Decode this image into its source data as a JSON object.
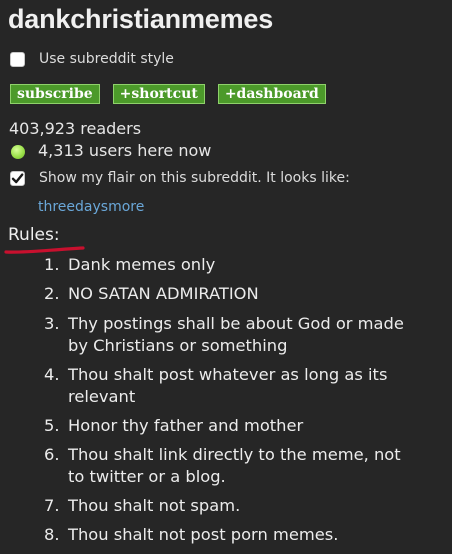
{
  "subreddit": {
    "name": "dankchristianmemes"
  },
  "style_option": {
    "label": "Use subreddit style",
    "checked": false
  },
  "buttons": {
    "subscribe": "subscribe",
    "shortcut": "+shortcut",
    "dashboard": "+dashboard"
  },
  "stats": {
    "readers": "403,923 readers",
    "online": "4,313 users here now"
  },
  "flair": {
    "label": "Show my flair on this subreddit. It looks like:",
    "checked": true,
    "value": "threedaysmore"
  },
  "rules": {
    "heading": "Rules:",
    "items": [
      {
        "num": "1.",
        "lines": [
          "Dank memes only"
        ]
      },
      {
        "num": "2.",
        "lines": [
          "NO SATAN ADMIRATION"
        ]
      },
      {
        "num": "3.",
        "lines": [
          "Thy postings shall be about God or made",
          "by Christians or something"
        ]
      },
      {
        "num": "4.",
        "lines": [
          "Thou shalt post whatever as long as its",
          "relevant"
        ]
      },
      {
        "num": "5.",
        "lines": [
          "Honor thy father and mother"
        ]
      },
      {
        "num": "6.",
        "lines": [
          "Thou shalt link directly to the meme, not",
          "to twitter or a blog."
        ]
      },
      {
        "num": "7.",
        "lines": [
          "Thou shalt not spam."
        ]
      },
      {
        "num": "8.",
        "lines": [
          "Thou shalt not post porn memes."
        ]
      }
    ]
  },
  "colors": {
    "background": "#262626",
    "button_green": "#4c9a2a",
    "flair_link": "#6aa7d8",
    "online_dot": "#9be04a",
    "underline_red": "#c8102e"
  }
}
